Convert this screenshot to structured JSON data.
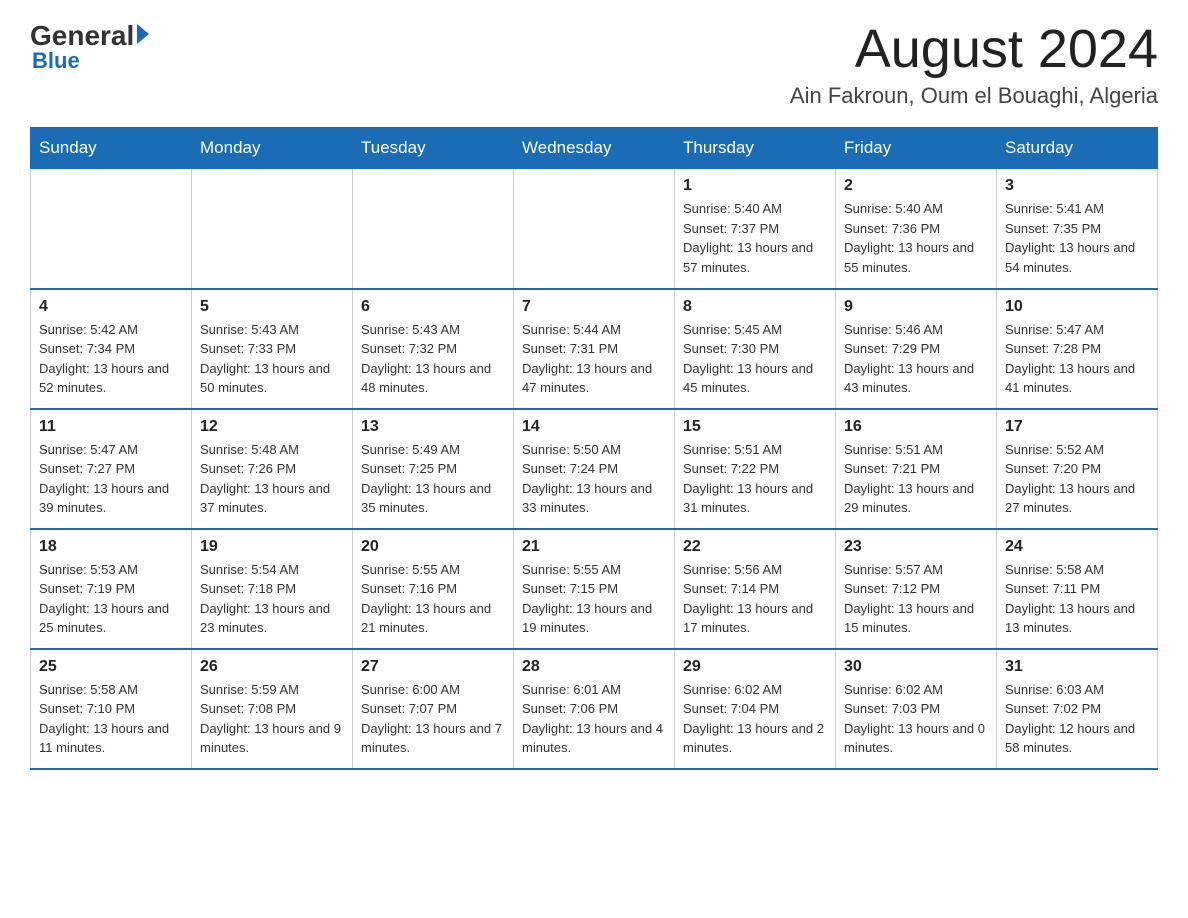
{
  "logo": {
    "general": "General",
    "arrow": "",
    "blue": "Blue"
  },
  "header": {
    "month": "August 2024",
    "location": "Ain Fakroun, Oum el Bouaghi, Algeria"
  },
  "days_of_week": [
    "Sunday",
    "Monday",
    "Tuesday",
    "Wednesday",
    "Thursday",
    "Friday",
    "Saturday"
  ],
  "weeks": [
    [
      {
        "day": "",
        "info": ""
      },
      {
        "day": "",
        "info": ""
      },
      {
        "day": "",
        "info": ""
      },
      {
        "day": "",
        "info": ""
      },
      {
        "day": "1",
        "info": "Sunrise: 5:40 AM\nSunset: 7:37 PM\nDaylight: 13 hours and 57 minutes."
      },
      {
        "day": "2",
        "info": "Sunrise: 5:40 AM\nSunset: 7:36 PM\nDaylight: 13 hours and 55 minutes."
      },
      {
        "day": "3",
        "info": "Sunrise: 5:41 AM\nSunset: 7:35 PM\nDaylight: 13 hours and 54 minutes."
      }
    ],
    [
      {
        "day": "4",
        "info": "Sunrise: 5:42 AM\nSunset: 7:34 PM\nDaylight: 13 hours and 52 minutes."
      },
      {
        "day": "5",
        "info": "Sunrise: 5:43 AM\nSunset: 7:33 PM\nDaylight: 13 hours and 50 minutes."
      },
      {
        "day": "6",
        "info": "Sunrise: 5:43 AM\nSunset: 7:32 PM\nDaylight: 13 hours and 48 minutes."
      },
      {
        "day": "7",
        "info": "Sunrise: 5:44 AM\nSunset: 7:31 PM\nDaylight: 13 hours and 47 minutes."
      },
      {
        "day": "8",
        "info": "Sunrise: 5:45 AM\nSunset: 7:30 PM\nDaylight: 13 hours and 45 minutes."
      },
      {
        "day": "9",
        "info": "Sunrise: 5:46 AM\nSunset: 7:29 PM\nDaylight: 13 hours and 43 minutes."
      },
      {
        "day": "10",
        "info": "Sunrise: 5:47 AM\nSunset: 7:28 PM\nDaylight: 13 hours and 41 minutes."
      }
    ],
    [
      {
        "day": "11",
        "info": "Sunrise: 5:47 AM\nSunset: 7:27 PM\nDaylight: 13 hours and 39 minutes."
      },
      {
        "day": "12",
        "info": "Sunrise: 5:48 AM\nSunset: 7:26 PM\nDaylight: 13 hours and 37 minutes."
      },
      {
        "day": "13",
        "info": "Sunrise: 5:49 AM\nSunset: 7:25 PM\nDaylight: 13 hours and 35 minutes."
      },
      {
        "day": "14",
        "info": "Sunrise: 5:50 AM\nSunset: 7:24 PM\nDaylight: 13 hours and 33 minutes."
      },
      {
        "day": "15",
        "info": "Sunrise: 5:51 AM\nSunset: 7:22 PM\nDaylight: 13 hours and 31 minutes."
      },
      {
        "day": "16",
        "info": "Sunrise: 5:51 AM\nSunset: 7:21 PM\nDaylight: 13 hours and 29 minutes."
      },
      {
        "day": "17",
        "info": "Sunrise: 5:52 AM\nSunset: 7:20 PM\nDaylight: 13 hours and 27 minutes."
      }
    ],
    [
      {
        "day": "18",
        "info": "Sunrise: 5:53 AM\nSunset: 7:19 PM\nDaylight: 13 hours and 25 minutes."
      },
      {
        "day": "19",
        "info": "Sunrise: 5:54 AM\nSunset: 7:18 PM\nDaylight: 13 hours and 23 minutes."
      },
      {
        "day": "20",
        "info": "Sunrise: 5:55 AM\nSunset: 7:16 PM\nDaylight: 13 hours and 21 minutes."
      },
      {
        "day": "21",
        "info": "Sunrise: 5:55 AM\nSunset: 7:15 PM\nDaylight: 13 hours and 19 minutes."
      },
      {
        "day": "22",
        "info": "Sunrise: 5:56 AM\nSunset: 7:14 PM\nDaylight: 13 hours and 17 minutes."
      },
      {
        "day": "23",
        "info": "Sunrise: 5:57 AM\nSunset: 7:12 PM\nDaylight: 13 hours and 15 minutes."
      },
      {
        "day": "24",
        "info": "Sunrise: 5:58 AM\nSunset: 7:11 PM\nDaylight: 13 hours and 13 minutes."
      }
    ],
    [
      {
        "day": "25",
        "info": "Sunrise: 5:58 AM\nSunset: 7:10 PM\nDaylight: 13 hours and 11 minutes."
      },
      {
        "day": "26",
        "info": "Sunrise: 5:59 AM\nSunset: 7:08 PM\nDaylight: 13 hours and 9 minutes."
      },
      {
        "day": "27",
        "info": "Sunrise: 6:00 AM\nSunset: 7:07 PM\nDaylight: 13 hours and 7 minutes."
      },
      {
        "day": "28",
        "info": "Sunrise: 6:01 AM\nSunset: 7:06 PM\nDaylight: 13 hours and 4 minutes."
      },
      {
        "day": "29",
        "info": "Sunrise: 6:02 AM\nSunset: 7:04 PM\nDaylight: 13 hours and 2 minutes."
      },
      {
        "day": "30",
        "info": "Sunrise: 6:02 AM\nSunset: 7:03 PM\nDaylight: 13 hours and 0 minutes."
      },
      {
        "day": "31",
        "info": "Sunrise: 6:03 AM\nSunset: 7:02 PM\nDaylight: 12 hours and 58 minutes."
      }
    ]
  ]
}
